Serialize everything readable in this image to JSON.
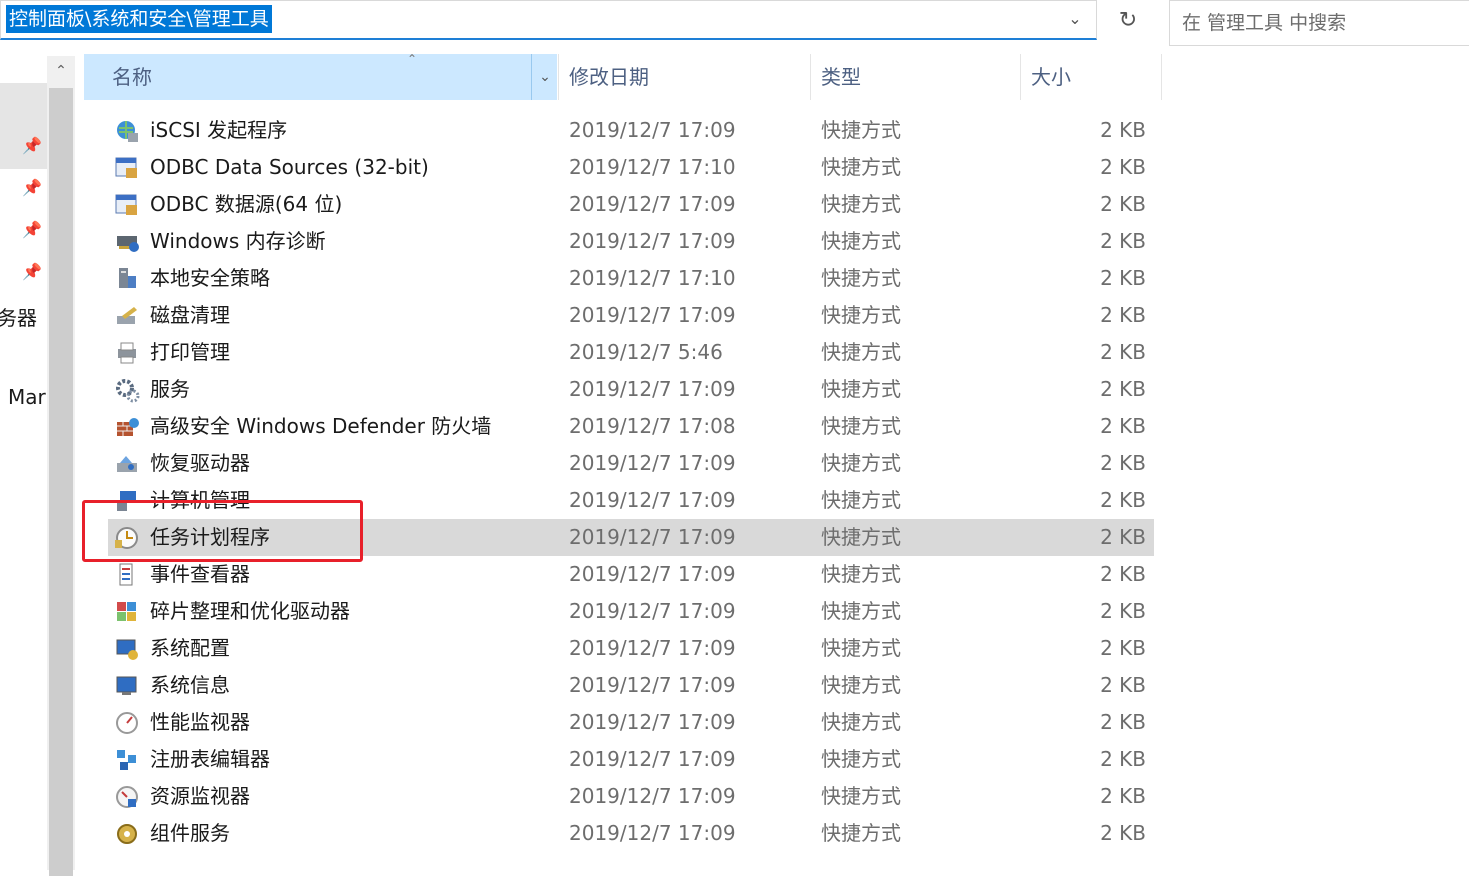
{
  "address_bar": {
    "path": "控制面板\\系统和安全\\管理工具"
  },
  "search": {
    "placeholder": "在 管理工具 中搜索"
  },
  "nav": {
    "partial_labels": [
      "务器",
      "Mar"
    ]
  },
  "columns": {
    "name": "名称",
    "date": "修改日期",
    "type": "类型",
    "size": "大小"
  },
  "selection_highlight_color": "#e8202a",
  "selected_row_color": "#d9d9d9",
  "files": [
    {
      "name": "iSCSI 发起程序",
      "date": "2019/12/7 17:09",
      "type": "快捷方式",
      "size": "2 KB",
      "icon": "iscsi-globe-icon"
    },
    {
      "name": "ODBC Data Sources (32-bit)",
      "date": "2019/12/7 17:10",
      "type": "快捷方式",
      "size": "2 KB",
      "icon": "odbc-icon"
    },
    {
      "name": "ODBC 数据源(64 位)",
      "date": "2019/12/7 17:09",
      "type": "快捷方式",
      "size": "2 KB",
      "icon": "odbc-icon"
    },
    {
      "name": "Windows 内存诊断",
      "date": "2019/12/7 17:09",
      "type": "快捷方式",
      "size": "2 KB",
      "icon": "memory-diagnostic-icon"
    },
    {
      "name": "本地安全策略",
      "date": "2019/12/7 17:10",
      "type": "快捷方式",
      "size": "2 KB",
      "icon": "local-security-policy-icon"
    },
    {
      "name": "磁盘清理",
      "date": "2019/12/7 17:09",
      "type": "快捷方式",
      "size": "2 KB",
      "icon": "disk-cleanup-icon"
    },
    {
      "name": "打印管理",
      "date": "2019/12/7 5:46",
      "type": "快捷方式",
      "size": "2 KB",
      "icon": "print-management-icon"
    },
    {
      "name": "服务",
      "date": "2019/12/7 17:09",
      "type": "快捷方式",
      "size": "2 KB",
      "icon": "services-gear-icon"
    },
    {
      "name": "高级安全 Windows Defender 防火墙",
      "date": "2019/12/7 17:08",
      "type": "快捷方式",
      "size": "2 KB",
      "icon": "firewall-icon"
    },
    {
      "name": "恢复驱动器",
      "date": "2019/12/7 17:09",
      "type": "快捷方式",
      "size": "2 KB",
      "icon": "recovery-drive-icon"
    },
    {
      "name": "计算机管理",
      "date": "2019/12/7 17:09",
      "type": "快捷方式",
      "size": "2 KB",
      "icon": "computer-management-icon"
    },
    {
      "name": "任务计划程序",
      "date": "2019/12/7 17:09",
      "type": "快捷方式",
      "size": "2 KB",
      "icon": "task-scheduler-clock-icon",
      "selected": true
    },
    {
      "name": "事件查看器",
      "date": "2019/12/7 17:09",
      "type": "快捷方式",
      "size": "2 KB",
      "icon": "event-viewer-icon"
    },
    {
      "name": "碎片整理和优化驱动器",
      "date": "2019/12/7 17:09",
      "type": "快捷方式",
      "size": "2 KB",
      "icon": "defrag-icon"
    },
    {
      "name": "系统配置",
      "date": "2019/12/7 17:09",
      "type": "快捷方式",
      "size": "2 KB",
      "icon": "system-config-icon"
    },
    {
      "name": "系统信息",
      "date": "2019/12/7 17:09",
      "type": "快捷方式",
      "size": "2 KB",
      "icon": "system-info-icon"
    },
    {
      "name": "性能监视器",
      "date": "2019/12/7 17:09",
      "type": "快捷方式",
      "size": "2 KB",
      "icon": "performance-monitor-icon"
    },
    {
      "name": "注册表编辑器",
      "date": "2019/12/7 17:09",
      "type": "快捷方式",
      "size": "2 KB",
      "icon": "registry-editor-icon"
    },
    {
      "name": "资源监视器",
      "date": "2019/12/7 17:09",
      "type": "快捷方式",
      "size": "2 KB",
      "icon": "resource-monitor-icon"
    },
    {
      "name": "组件服务",
      "date": "2019/12/7 17:09",
      "type": "快捷方式",
      "size": "2 KB",
      "icon": "component-services-icon"
    }
  ]
}
